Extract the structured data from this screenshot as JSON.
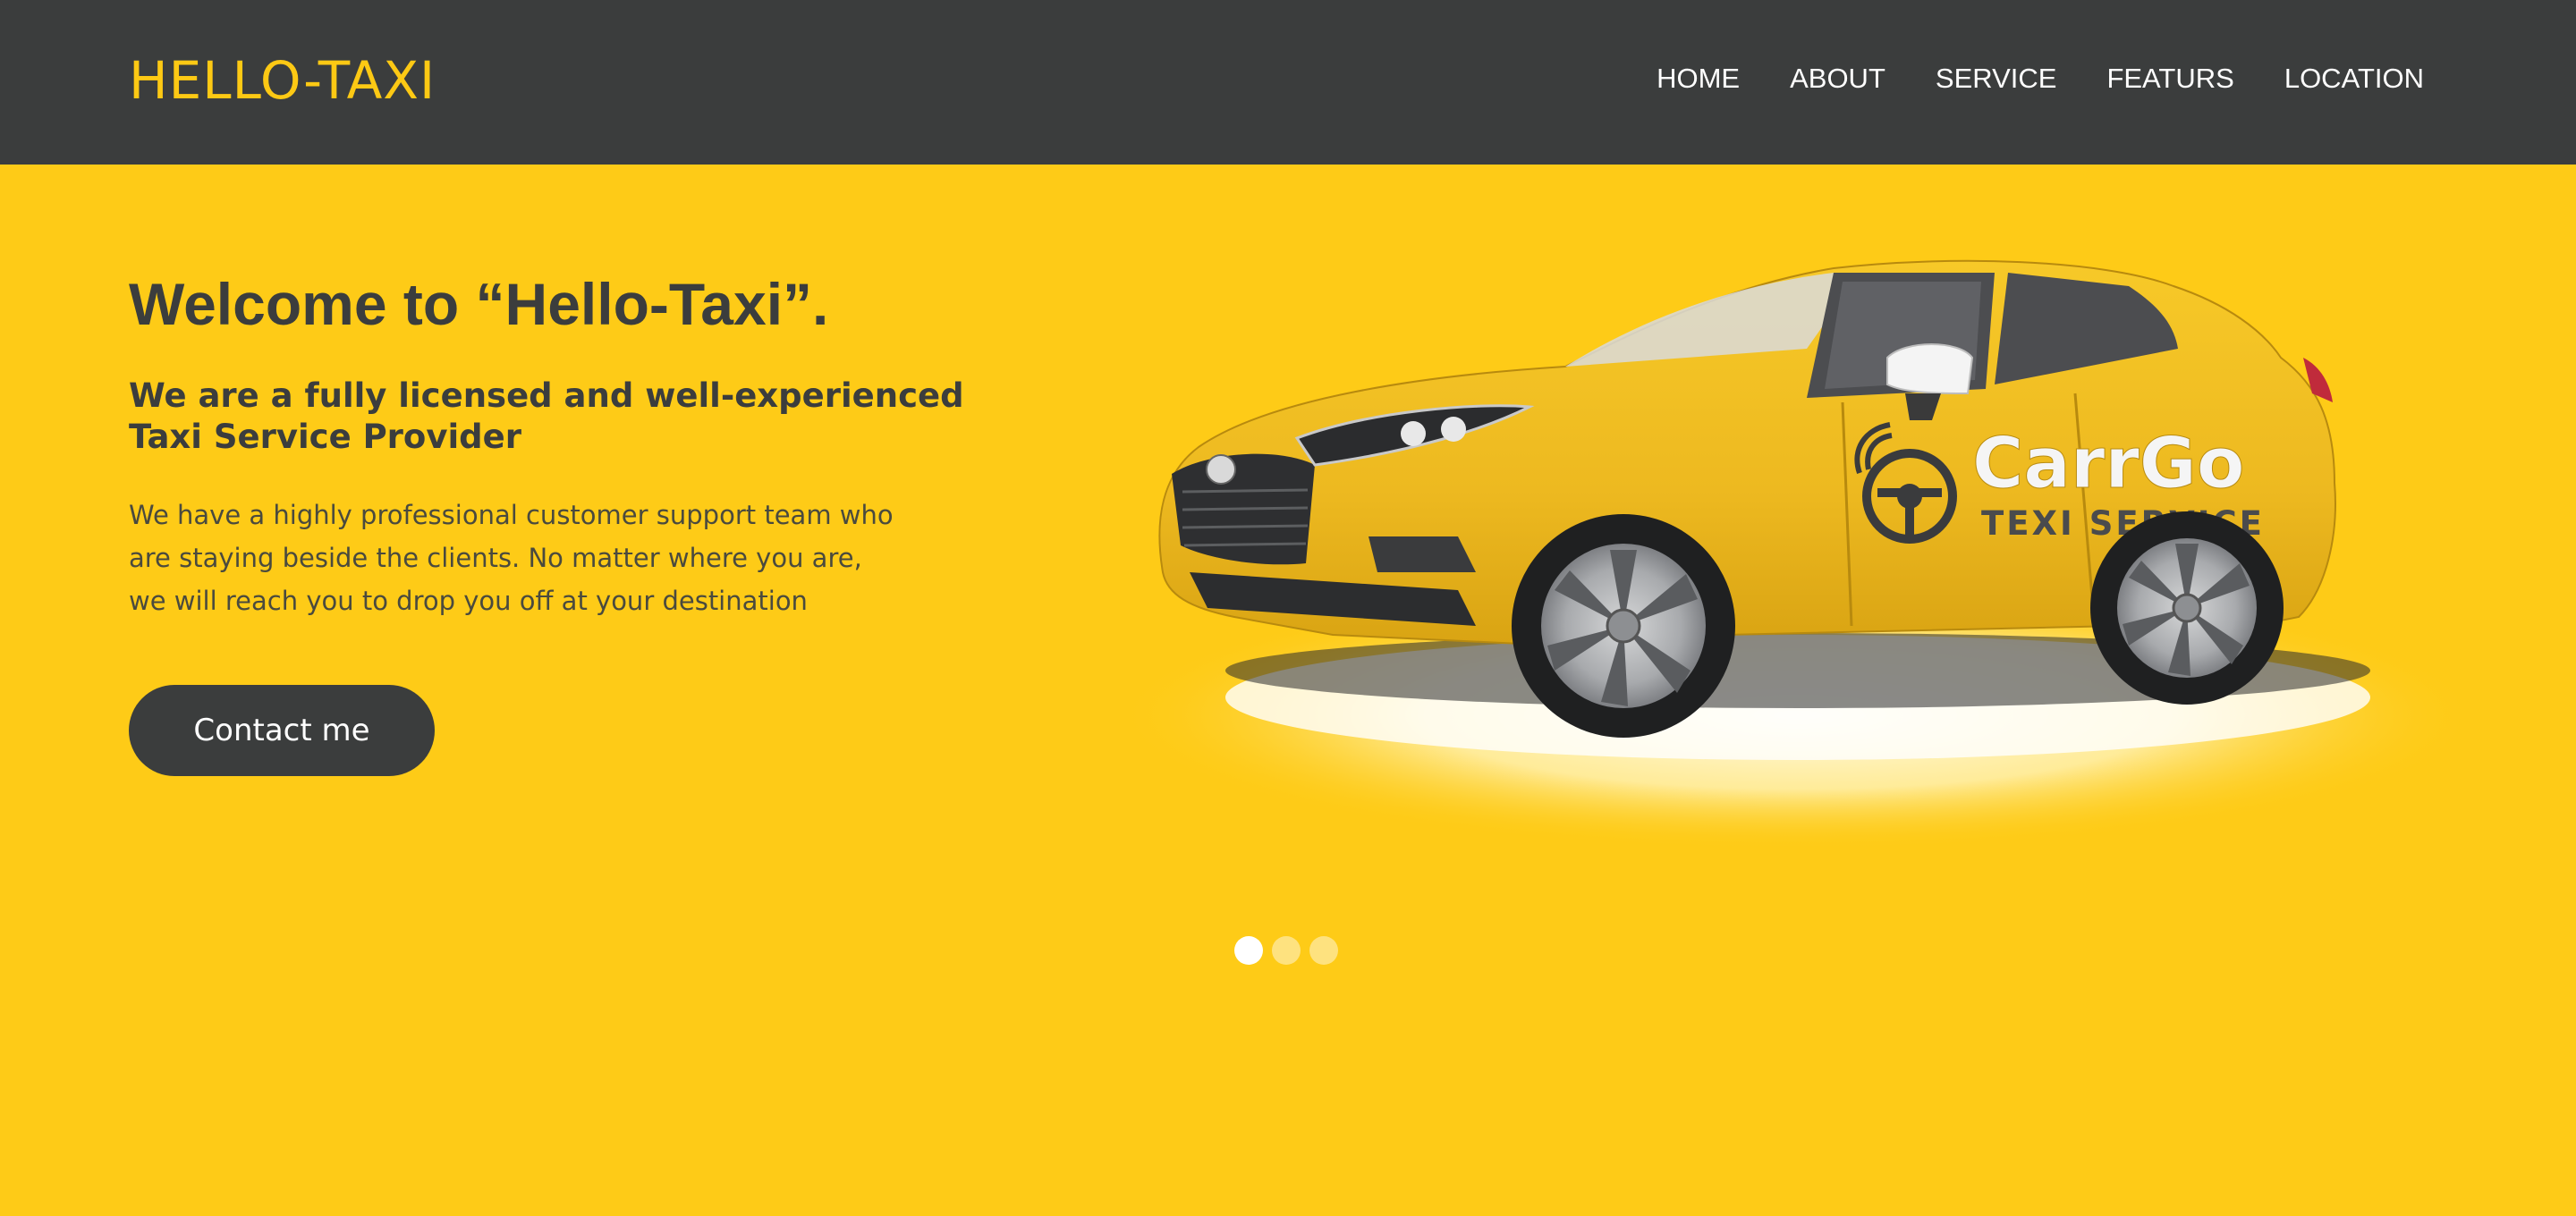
{
  "header": {
    "brand": "HELLO-TAXI",
    "nav": [
      "HOME",
      "ABOUT",
      "SERVICE",
      "FEATURS",
      "LOCATION"
    ]
  },
  "hero": {
    "title": "Welcome to “Hello-Taxi”.",
    "subtitle_lines": [
      "We are a fully licensed and well-experienced",
      "Taxi Service Provider"
    ],
    "body_lines": [
      "We have a highly professional customer support team who",
      "are staying beside the clients. No matter where you are,",
      "we will reach you to drop you off at your destination"
    ],
    "cta_label": "Contact me"
  },
  "car_image": {
    "brand_text": "CarrGo",
    "service_text": "TEXI SERVICE",
    "icon": "steering-wheel-icon"
  },
  "slider": {
    "count": 3,
    "active_index": 0
  },
  "colors": {
    "header_bg": "#3B3D3D",
    "brand_yellow": "#FDC914",
    "hero_bg": "#FECB17",
    "text_dark": "#3B3D3D",
    "white": "#FFFFFF"
  }
}
